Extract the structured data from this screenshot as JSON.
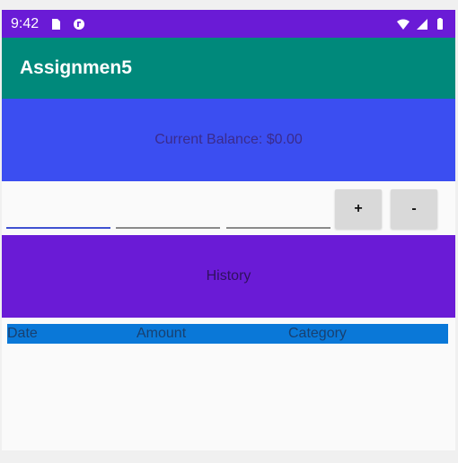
{
  "status_bar": {
    "time": "9:42",
    "icons": [
      "sd-card-icon",
      "circle-badge-icon",
      "wifi-icon",
      "signal-icon",
      "battery-icon"
    ]
  },
  "app_bar": {
    "title": "Assignmen5"
  },
  "balance": {
    "text": "Current Balance: $0.00"
  },
  "inputs": {
    "field1_value": "",
    "field2_value": "",
    "field3_value": "",
    "plus_label": "+",
    "minus_label": "-"
  },
  "history": {
    "title": "History"
  },
  "table": {
    "headers": [
      "Date",
      "Amount",
      "Category"
    ]
  },
  "colors": {
    "status_bar": "#6a1bd6",
    "app_bar": "#00897b",
    "balance": "#3b4ef1",
    "history": "#6a1bd6",
    "table_header": "#0a78d8",
    "button": "#d9d9d9"
  }
}
